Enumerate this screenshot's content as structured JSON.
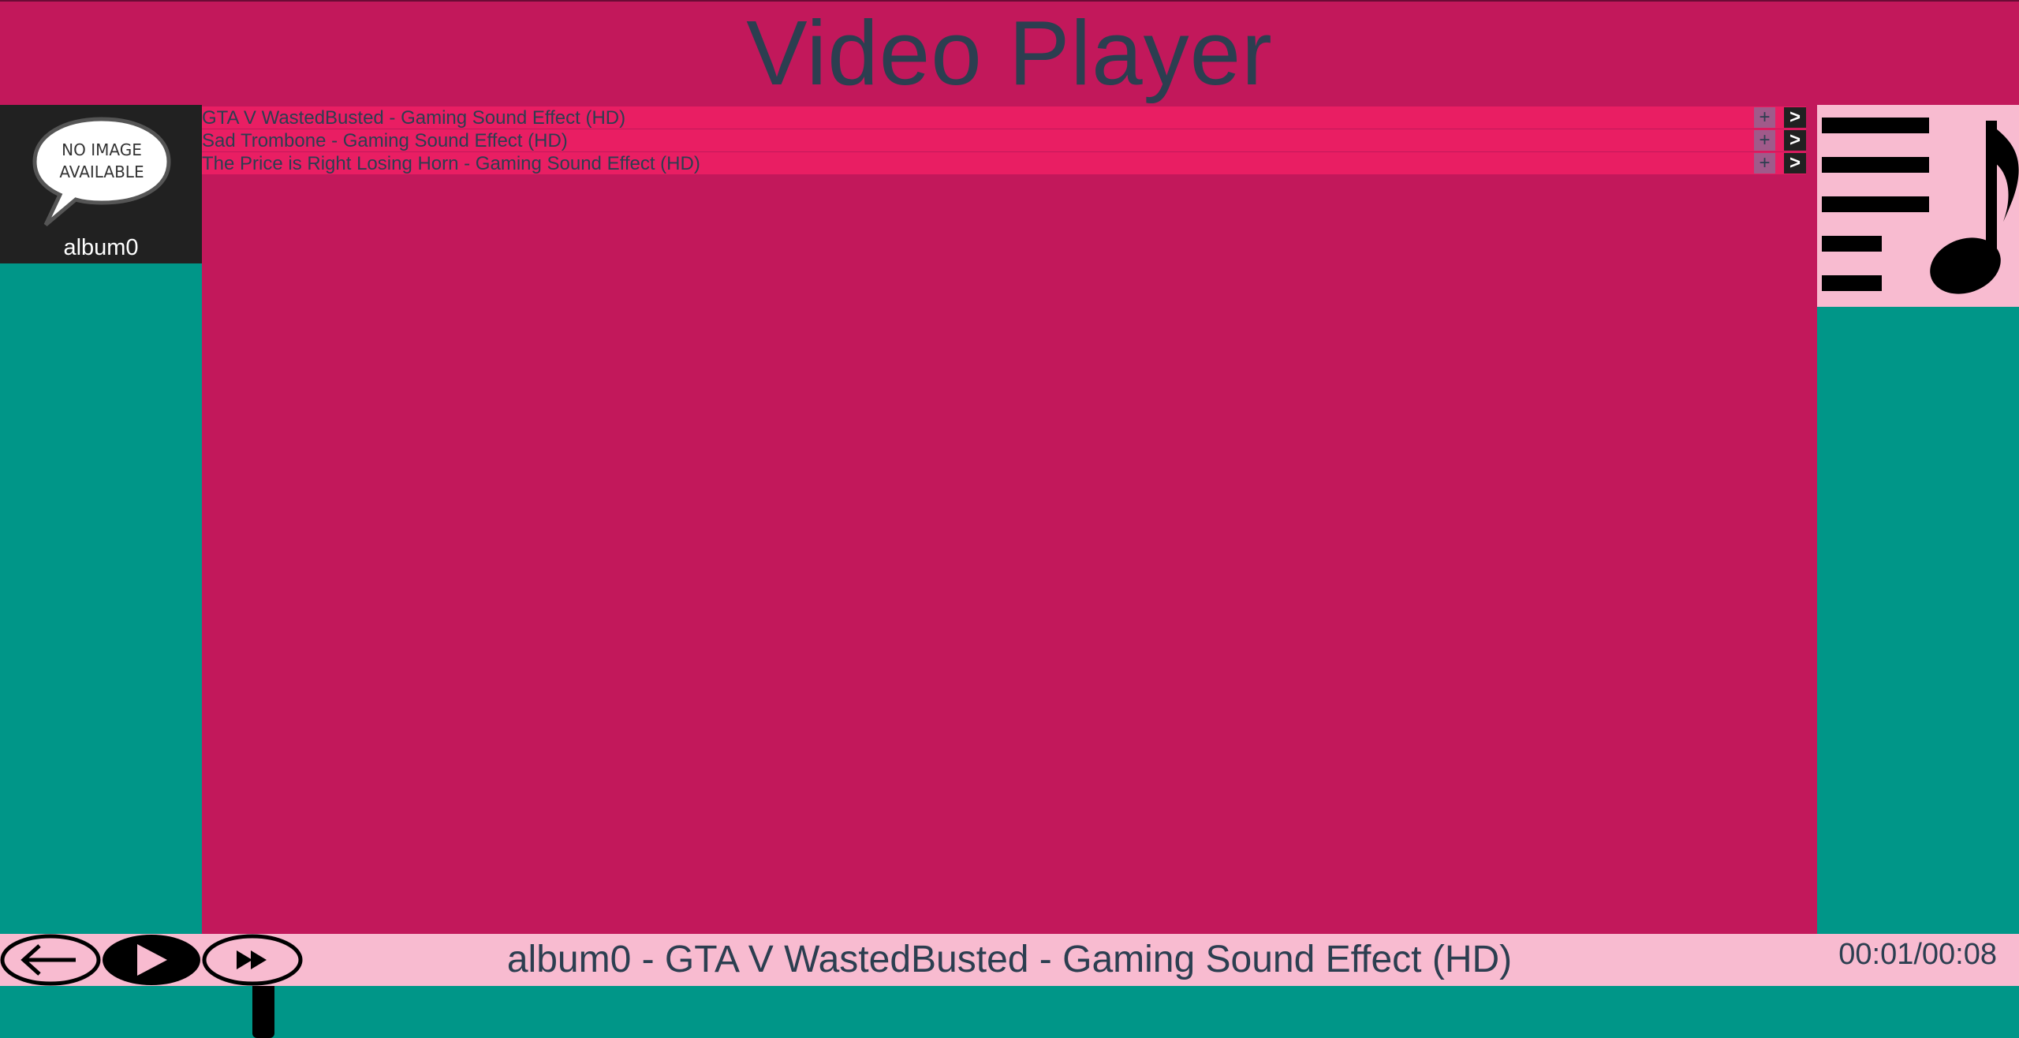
{
  "header": {
    "title": "Video Player"
  },
  "album": {
    "name": "album0",
    "art_text_line1": "NO IMAGE",
    "art_text_line2": "AVAILABLE"
  },
  "tracks": [
    {
      "title": "GTA V WastedBusted - Gaming Sound Effect (HD)",
      "add_label": "+",
      "play_label": ">"
    },
    {
      "title": "Sad Trombone - Gaming Sound Effect (HD)",
      "add_label": "+",
      "play_label": ">"
    },
    {
      "title": "The Price is Right Losing Horn - Gaming Sound Effect (HD)",
      "add_label": "+",
      "play_label": ">"
    }
  ],
  "player": {
    "now_playing": "album0 - GTA V WastedBusted - Gaming Sound Effect (HD)",
    "time": "00:01/00:08",
    "progress_fraction": 0.125
  },
  "icons": {
    "back": "arrow-left-icon",
    "play": "play-icon",
    "next": "fast-forward-icon",
    "playlist": "playlist-music-icon"
  },
  "colors": {
    "header_bg": "#c2185b",
    "track_row_bg": "#e91e63",
    "sidebar_bg": "#009688",
    "control_bar_bg": "#f8bbd0",
    "text": "#2c3e50"
  }
}
